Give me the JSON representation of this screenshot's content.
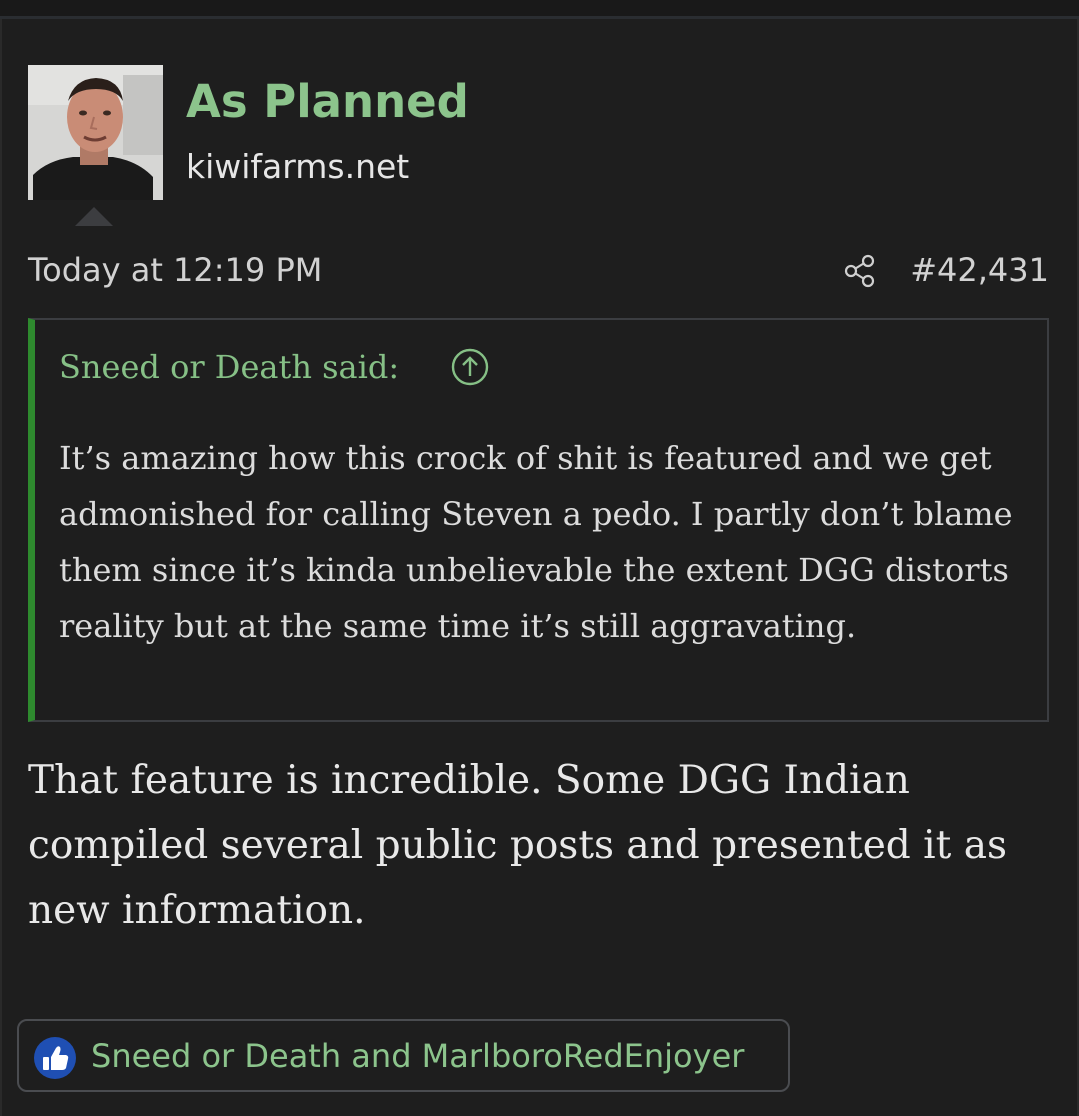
{
  "post": {
    "username": "As Planned",
    "user_title": "kiwifarms.net",
    "timestamp": "Today at 12:19 PM",
    "post_number": "#42,431",
    "quote": {
      "author": "Sneed or Death said:",
      "text": "It’s amazing how this crock of shit is featured and we get admonished for calling Steven a pedo. I partly don’t blame them since it’s kinda unbelievable the extent DGG distorts reality but at the same time it’s still aggravating."
    },
    "body": "That feature is incredible. Some DGG Indian compiled several public posts and presented it as new information.",
    "reactions": "Sneed or Death and MarlboroRedEnjoyer"
  },
  "icons": {
    "share": "share-icon",
    "jump": "arrow-up-circle-icon",
    "like": "thumbs-up-icon"
  },
  "colors": {
    "background": "#1e1e1e",
    "username": "#8cc48c",
    "quote_bar": "#2e8a2e",
    "like_badge": "#1f4fb3"
  }
}
